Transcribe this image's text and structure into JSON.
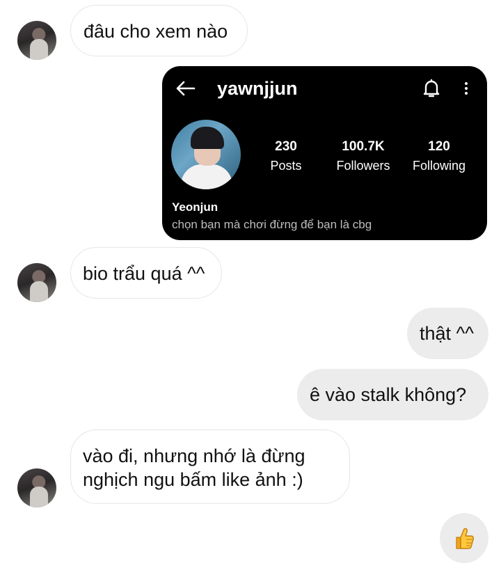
{
  "messages": [
    {
      "text": "đâu cho xem nào"
    },
    {
      "text": "bio trẩu quá ^^"
    },
    {
      "text": "thật ^^"
    },
    {
      "text": "ê vào stalk không?"
    },
    {
      "text_line1": "vào đi, nhưng nhớ là đừng",
      "text_line2": "nghịch ngu bấm like ảnh :)"
    }
  ],
  "profile_card": {
    "username": "yawnjjun",
    "posts_count": "230",
    "posts_label": "Posts",
    "followers_count": "100.7K",
    "followers_label": "Followers",
    "following_count": "120",
    "following_label": "Following",
    "display_name": "Yeonjun",
    "bio": "chọn bạn mà chơi đừng để bạn là cbg"
  },
  "icons": {
    "back": "arrow-left-icon",
    "bell": "bell-icon",
    "more": "more-vertical-icon",
    "like": "thumbs-up-icon"
  }
}
